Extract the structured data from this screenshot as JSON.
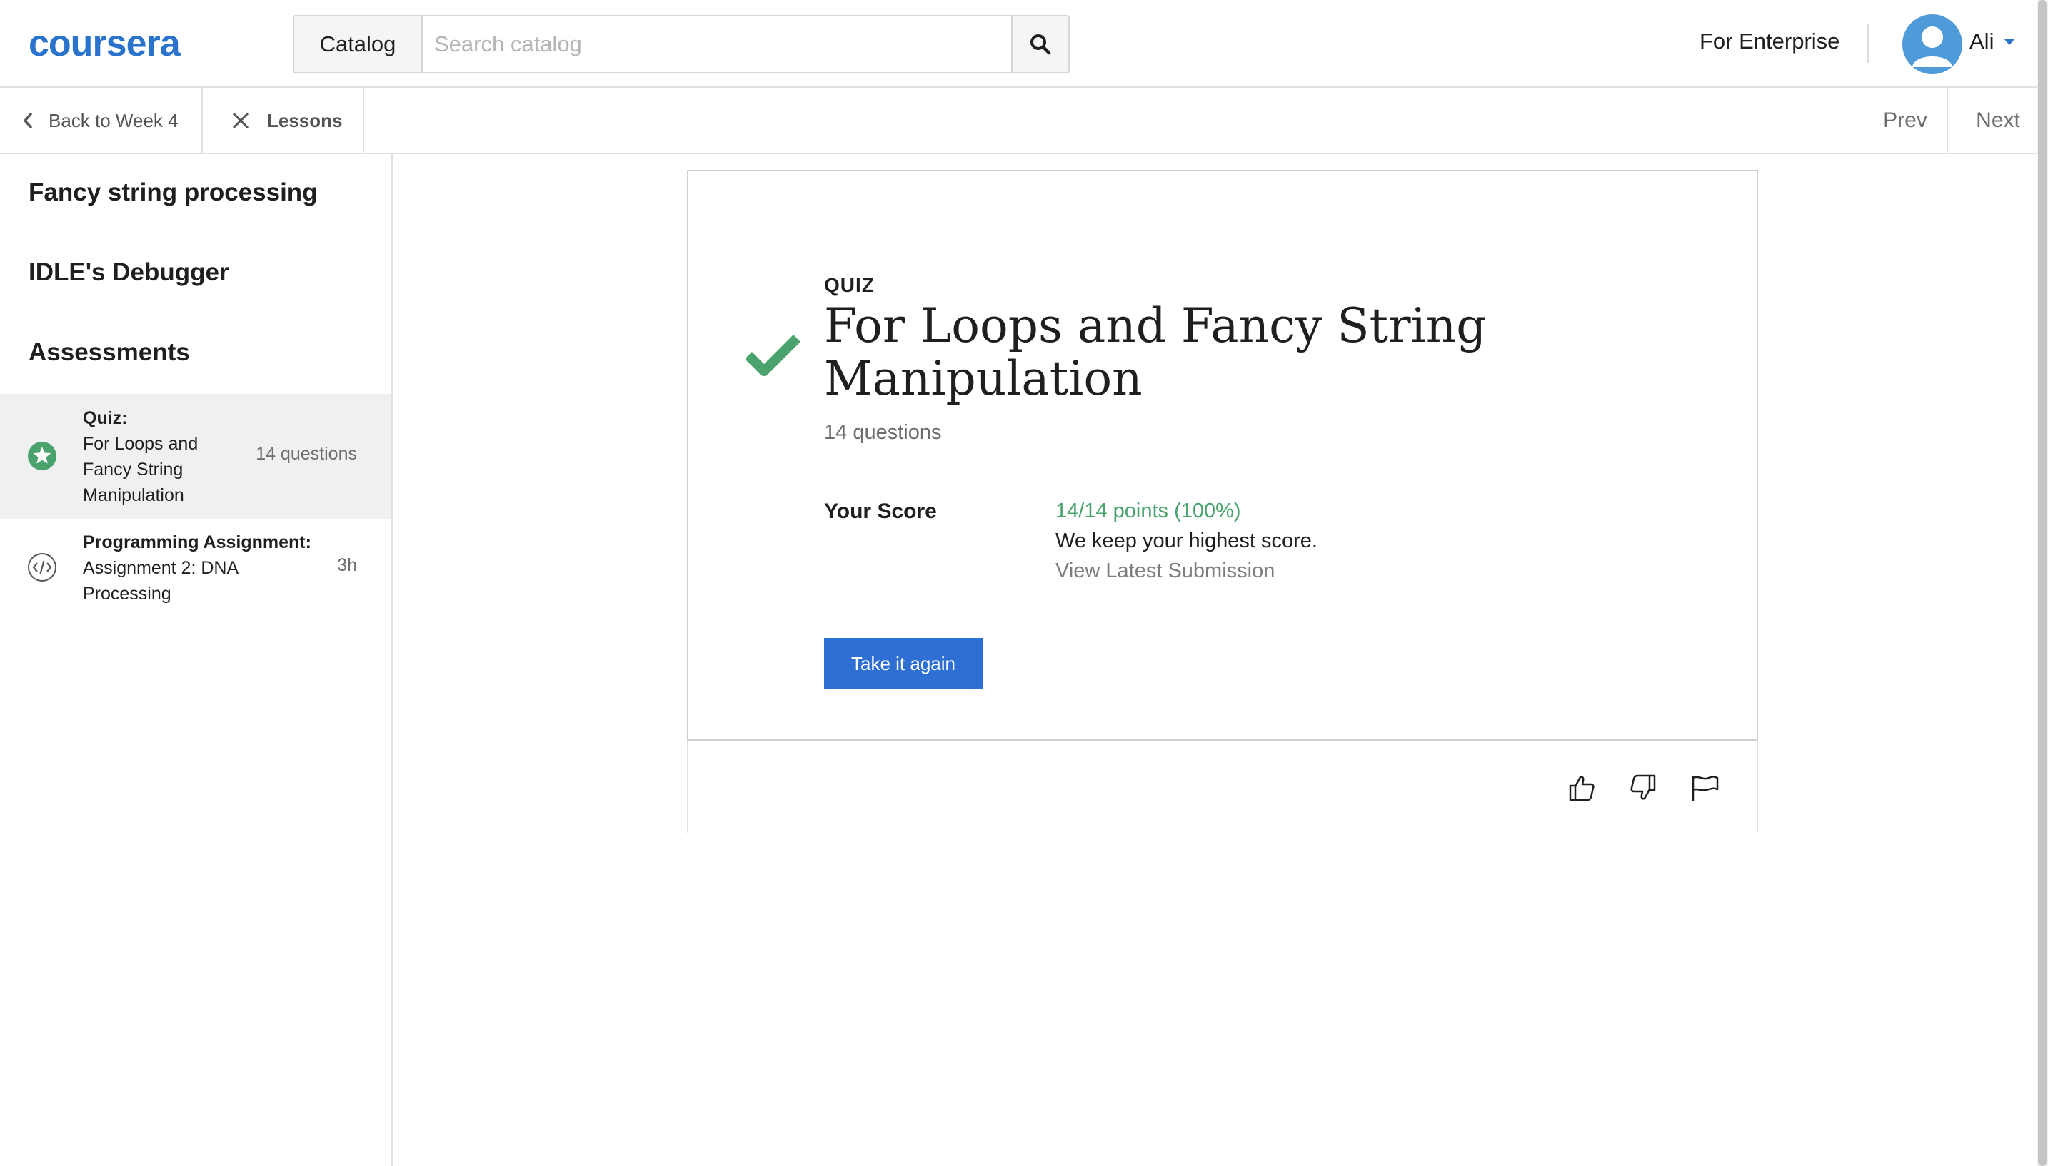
{
  "header": {
    "logo_text": "coursera",
    "catalog_label": "Catalog",
    "search_placeholder": "Search catalog",
    "enterprise_label": "For Enterprise",
    "user_name": "Ali"
  },
  "subnav": {
    "back_label": "Back to Week 4",
    "lessons_label": "Lessons",
    "prev_label": "Prev",
    "next_label": "Next"
  },
  "sidebar": {
    "sections": [
      "Fancy string processing",
      "IDLE's Debugger",
      "Assessments"
    ],
    "items": [
      {
        "kind": "Quiz:",
        "name_lines": [
          "For Loops and",
          "Fancy String",
          "Manipulation"
        ],
        "meta": "14 questions",
        "icon": "star-complete-icon"
      },
      {
        "kind": "Programming Assignment:",
        "name_lines": [
          "Assignment 2: DNA",
          "Processing"
        ],
        "meta": "3h",
        "icon": "code-icon"
      }
    ]
  },
  "main": {
    "type_label": "QUIZ",
    "title": "For Loops and Fancy String Manipulation",
    "question_count": "14 questions",
    "score_label": "Your Score",
    "score_points": "14/14 points (100%)",
    "score_note": "We keep your highest score.",
    "view_submission": "View Latest Submission",
    "retake_label": "Take it again"
  },
  "colors": {
    "brand_blue": "#2a73cc",
    "success_green": "#4aa36c",
    "button_blue": "#2d6fd2",
    "avatar_blue": "#4f9bd9"
  }
}
